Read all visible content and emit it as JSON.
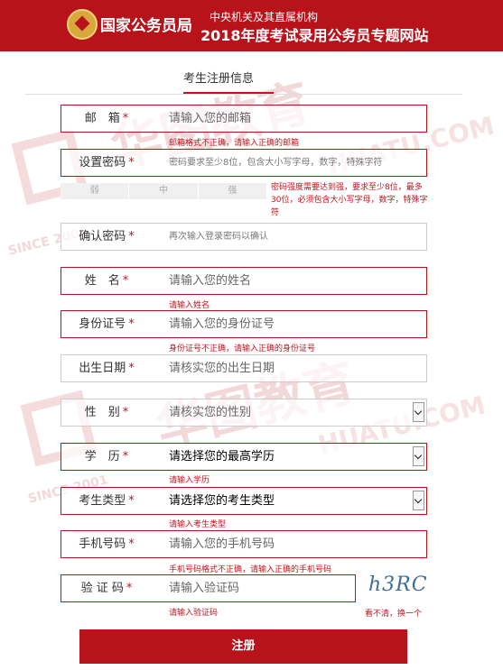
{
  "header": {
    "site_name": "国家公务员局",
    "subtitle_top": "中央机关及其直属机构",
    "subtitle_main": "2018年度考试录用公务员专题网站"
  },
  "watermark": {
    "brand_cn": "华图教育",
    "brand_en": "HUATU.COM",
    "since": "SINCE 2001"
  },
  "tab": {
    "label": "考生注册信息"
  },
  "form": {
    "email": {
      "label": "邮　箱",
      "placeholder": "请输入您的邮箱",
      "error": "邮箱格式不正确，请输入正确的邮箱"
    },
    "password": {
      "label": "设置密码",
      "placeholder": "密码要求至少8位，包含大小写字母，数字，特殊字符"
    },
    "strength": {
      "weak": "弱",
      "medium": "中",
      "strong": "强"
    },
    "password_hint": "密码强度需要达到强，要求至少8位，最多30位，必须包含大小写字母，数字，特殊字符",
    "confirm": {
      "label": "确认密码",
      "placeholder": "再次输入登录密码以确认"
    },
    "name": {
      "label": "姓　名",
      "placeholder": "请输入您的姓名",
      "error": "请输入姓名"
    },
    "id_number": {
      "label": "身份证号",
      "placeholder": "请输入您的身份证号",
      "error": "身份证号不正确，请输入正确的身份证号"
    },
    "birth": {
      "label": "出生日期",
      "placeholder": "请核实您的出生日期"
    },
    "gender": {
      "label": "性　别",
      "value": "请核实您的性别"
    },
    "education": {
      "label": "学　历",
      "value": "请选择您的最高学历",
      "error": "请输入学历"
    },
    "candidate_type": {
      "label": "考生类型",
      "value": "请选择您的考生类型",
      "error": "请输入考生类型"
    },
    "phone": {
      "label": "手机号码",
      "placeholder": "请输入您的手机号码",
      "error": "手机号码格式不正确，请输入正确的手机号码"
    },
    "captcha": {
      "label": "验 证 码",
      "placeholder": "请输入验证码",
      "error": "请输入验证码",
      "image_text": "h3RC",
      "refresh": "看不清，换一个"
    },
    "star": "*",
    "submit": "注册"
  }
}
